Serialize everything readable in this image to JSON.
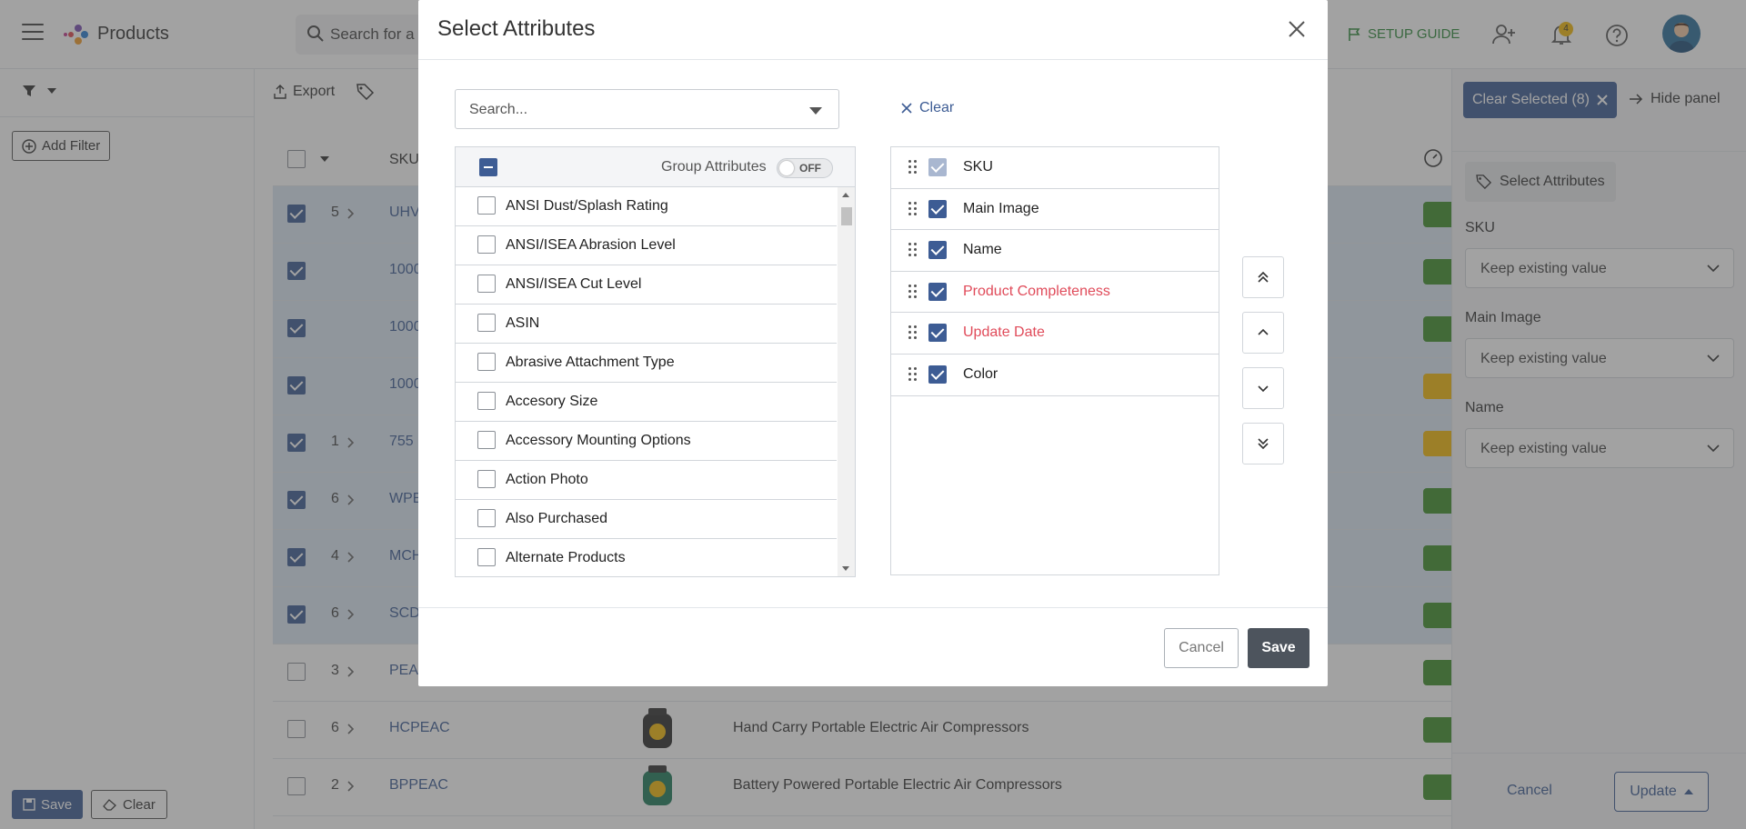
{
  "header": {
    "app_title": "Products",
    "search_placeholder": "Search for a",
    "setup_guide": "SETUP GUIDE",
    "notification_count": "4"
  },
  "filter_panel": {
    "add_filter": "Add Filter",
    "save": "Save",
    "clear": "Clear"
  },
  "toolbar": {
    "export": "Export"
  },
  "grid": {
    "sku_header": "SKU",
    "rows": [
      {
        "selected": true,
        "count": "5",
        "sku": "UHV",
        "name": "",
        "status": "#3f8f2a"
      },
      {
        "selected": true,
        "count": "",
        "sku": "1000",
        "name": "",
        "status": "#3f8f2a"
      },
      {
        "selected": true,
        "count": "",
        "sku": "1000",
        "name": "",
        "status": "#3f8f2a"
      },
      {
        "selected": true,
        "count": "",
        "sku": "1000",
        "name": "",
        "status": "#f2b90a"
      },
      {
        "selected": true,
        "count": "1",
        "sku": "755",
        "name": "",
        "status": "#f2b90a"
      },
      {
        "selected": true,
        "count": "6",
        "sku": "WPE",
        "name": "",
        "status": "#3f8f2a"
      },
      {
        "selected": true,
        "count": "4",
        "sku": "MCH",
        "name": "",
        "status": "#3f8f2a"
      },
      {
        "selected": true,
        "count": "6",
        "sku": "SCD",
        "name": "",
        "status": "#3f8f2a"
      },
      {
        "selected": false,
        "count": "3",
        "sku": "PEAC",
        "name": "",
        "status": "#3f8f2a"
      },
      {
        "selected": false,
        "count": "6",
        "sku": "HCPEAC",
        "name": "Hand Carry Portable Electric Air Compressors",
        "status": "#3f8f2a"
      },
      {
        "selected": false,
        "count": "2",
        "sku": "BPPEAC",
        "name": "Battery Powered Portable Electric Air Compressors",
        "status": "#3f8f2a"
      }
    ]
  },
  "right_panel": {
    "clear_selected": "Clear Selected (8)",
    "hide_panel": "Hide panel",
    "select_attributes": "Select Attributes",
    "fields": [
      {
        "label": "SKU",
        "value": "Keep existing value"
      },
      {
        "label": "Main Image",
        "value": "Keep existing value"
      },
      {
        "label": "Name",
        "value": "Keep existing value"
      }
    ],
    "cancel": "Cancel",
    "update": "Update"
  },
  "modal": {
    "title": "Select Attributes",
    "search_placeholder": "Search...",
    "clear": "Clear",
    "group_attributes": "Group Attributes",
    "toggle_state": "OFF",
    "available": [
      "ANSI Dust/Splash Rating",
      "ANSI/ISEA Abrasion Level",
      "ANSI/ISEA Cut Level",
      "ASIN",
      "Abrasive Attachment Type",
      "Accesory Size",
      "Accessory Mounting Options",
      "Action Photo",
      "Also Purchased",
      "Alternate Products"
    ],
    "selected": [
      {
        "label": "SKU",
        "highlight": false,
        "locked": true
      },
      {
        "label": "Main Image",
        "highlight": false,
        "locked": false
      },
      {
        "label": "Name",
        "highlight": false,
        "locked": false
      },
      {
        "label": "Product Completeness",
        "highlight": true,
        "locked": false
      },
      {
        "label": "Update Date",
        "highlight": true,
        "locked": false
      },
      {
        "label": "Color",
        "highlight": false,
        "locked": false
      }
    ],
    "cancel": "Cancel",
    "save": "Save"
  },
  "colors": {
    "primary": "#3d5c94",
    "highlight_red": "#e04b5a",
    "status_green": "#3f8f2a",
    "status_yellow": "#f2b90a"
  }
}
